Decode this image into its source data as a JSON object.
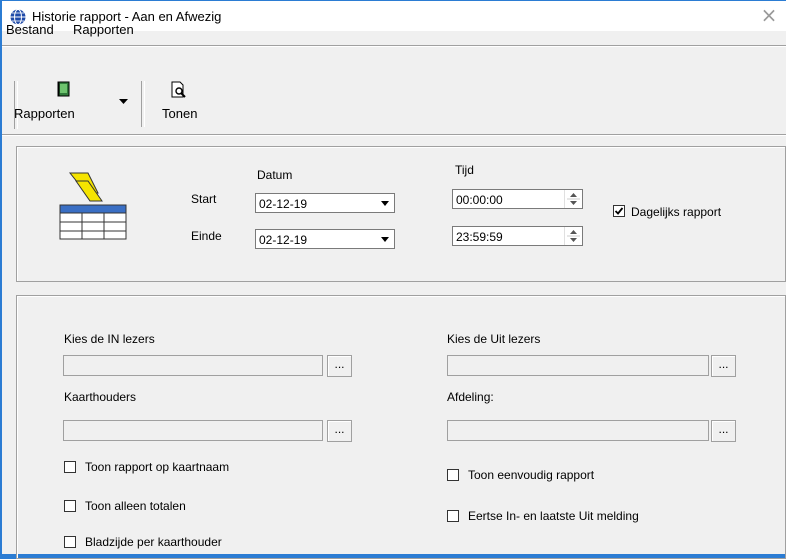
{
  "window": {
    "title": "Historie rapport - Aan en Afwezig",
    "close": "×"
  },
  "menu": {
    "items": [
      "Bestand",
      "Rapporten"
    ]
  },
  "toolbar": {
    "rapporten_label": "Rapporten",
    "tonen_label": "Tonen"
  },
  "period": {
    "datum_header": "Datum",
    "tijd_header": "Tijd",
    "start_label": "Start",
    "einde_label": "Einde",
    "start_date": "02-12-19",
    "end_date": "02-12-19",
    "start_time": "00:00:00",
    "end_time": "23:59:59",
    "daily_label": "Dagelijks rapport",
    "daily_checked": true
  },
  "filters": {
    "in_readers_label": "Kies de IN lezers",
    "out_readers_label": "Kies de Uit lezers",
    "cardholders_label": "Kaarthouders",
    "department_label": "Afdeling:",
    "browse": "..."
  },
  "options": {
    "cardname_label": "Toon rapport op kaartnaam",
    "totals_label": "Toon alleen totalen",
    "page_per_holder_label": "Bladzijde per kaarthouder",
    "simple_label": "Toon eenvoudig rapport",
    "first_last_label": "Eertse In- en laatste Uit melding"
  },
  "colors": {
    "title_accent": "#2b7cd3",
    "icon_yellow": "#f5e400",
    "icon_blue": "#3a6fc4"
  },
  "icons": [
    "globe-icon",
    "close-icon",
    "report-book-icon",
    "preview-icon",
    "report-table-icon"
  ]
}
